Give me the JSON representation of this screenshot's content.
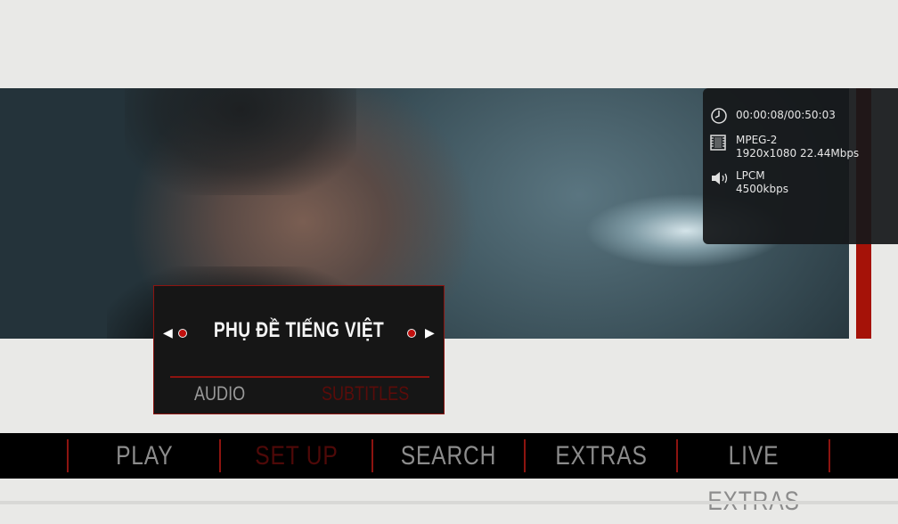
{
  "info": {
    "time": "00:00:08/00:50:03",
    "video_codec": "MPEG-2",
    "video_details": "1920x1080 22.44Mbps",
    "audio_codec": "LPCM",
    "audio_bitrate": "4500kbps"
  },
  "popup": {
    "value": "PHỤ ĐỀ TIẾNG VIỆT",
    "tabs": [
      "AUDIO",
      "SUBTITLES"
    ],
    "active_tab": "SUBTITLES"
  },
  "nav": {
    "items": [
      "PLAY",
      "SET UP",
      "SEARCH",
      "EXTRAS",
      "LIVE EXTRAS"
    ],
    "active": "SET UP"
  },
  "icons": {
    "time": "clock-icon",
    "video": "film-icon",
    "audio": "speaker-icon",
    "prev": "left-arrow-icon",
    "next": "right-arrow-icon"
  },
  "colors": {
    "accent_red": "#a51208",
    "dark_red_active": "#4e0908",
    "nav_inactive": "#8c8c8c"
  }
}
